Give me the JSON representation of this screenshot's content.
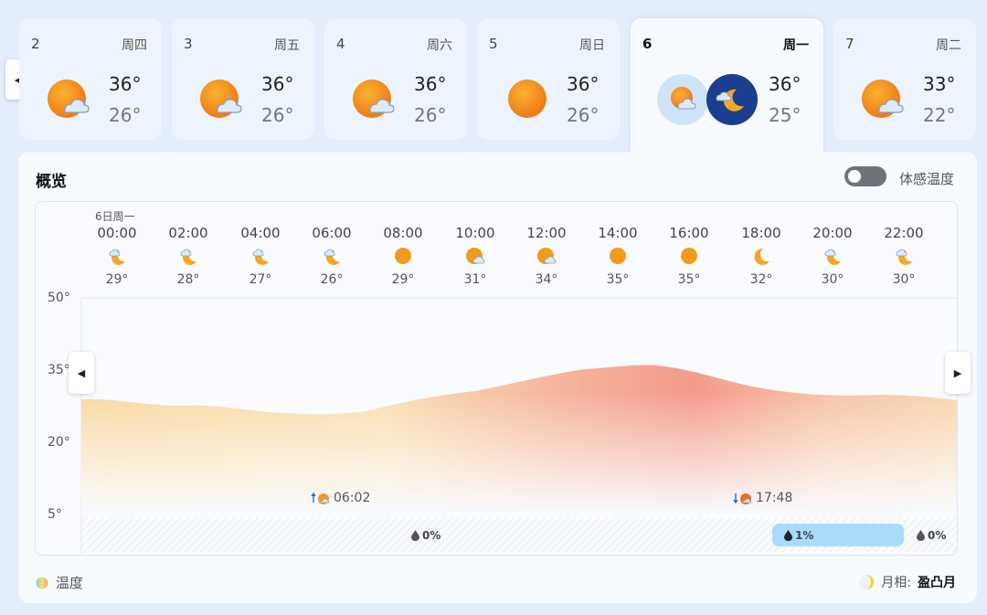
{
  "days": [
    {
      "num": "2",
      "week": "周四",
      "high": "36°",
      "low": "26°",
      "icon": "sun-cloud-icon",
      "active": false
    },
    {
      "num": "3",
      "week": "周五",
      "high": "36°",
      "low": "26°",
      "icon": "sun-cloud-icon",
      "active": false
    },
    {
      "num": "4",
      "week": "周六",
      "high": "36°",
      "low": "26°",
      "icon": "sun-cloud-icon",
      "active": false
    },
    {
      "num": "5",
      "week": "周日",
      "high": "36°",
      "low": "26°",
      "icon": "sun-icon",
      "active": false
    },
    {
      "num": "6",
      "week": "周一",
      "high": "36°",
      "low": "25°",
      "icon": "sun-cloud-moon-cloud-icon",
      "active": true
    },
    {
      "num": "7",
      "week": "周二",
      "high": "33°",
      "low": "22°",
      "icon": "sun-cloud-icon",
      "active": false
    }
  ],
  "overview": {
    "title": "概览",
    "feels_like_label": "体感温度",
    "feels_like_on": false,
    "date_label": "6日周一"
  },
  "hours": [
    {
      "time": "00:00",
      "temp": "29°",
      "icon": "moon-cloud-icon"
    },
    {
      "time": "02:00",
      "temp": "28°",
      "icon": "moon-cloud-icon"
    },
    {
      "time": "04:00",
      "temp": "27°",
      "icon": "moon-cloud-icon"
    },
    {
      "time": "06:00",
      "temp": "26°",
      "icon": "moon-cloud-icon"
    },
    {
      "time": "08:00",
      "temp": "29°",
      "icon": "sun-icon"
    },
    {
      "time": "10:00",
      "temp": "31°",
      "icon": "sun-cloud-icon"
    },
    {
      "time": "12:00",
      "temp": "34°",
      "icon": "sun-cloud-icon"
    },
    {
      "time": "14:00",
      "temp": "35°",
      "icon": "sun-icon"
    },
    {
      "time": "16:00",
      "temp": "35°",
      "icon": "sun-icon"
    },
    {
      "time": "18:00",
      "temp": "32°",
      "icon": "moon-icon"
    },
    {
      "time": "20:00",
      "temp": "30°",
      "icon": "moon-cloud-icon"
    },
    {
      "time": "22:00",
      "temp": "30°",
      "icon": "moon-cloud-icon"
    }
  ],
  "y_axis": [
    "50°",
    "35°",
    "20°",
    "5°"
  ],
  "sunrise": "06:02",
  "sunset": "17:48",
  "precip": {
    "left": "0%",
    "highlight": "1%",
    "right": "0%"
  },
  "legend": {
    "temp_label": "温度",
    "moon_label": "月相:",
    "moon_value": "盈凸月"
  },
  "colors": {
    "warm": "#f4a28c",
    "mild": "#f9e3b2",
    "rain": "#a9dcfb",
    "sun": "#f39a1b"
  }
}
